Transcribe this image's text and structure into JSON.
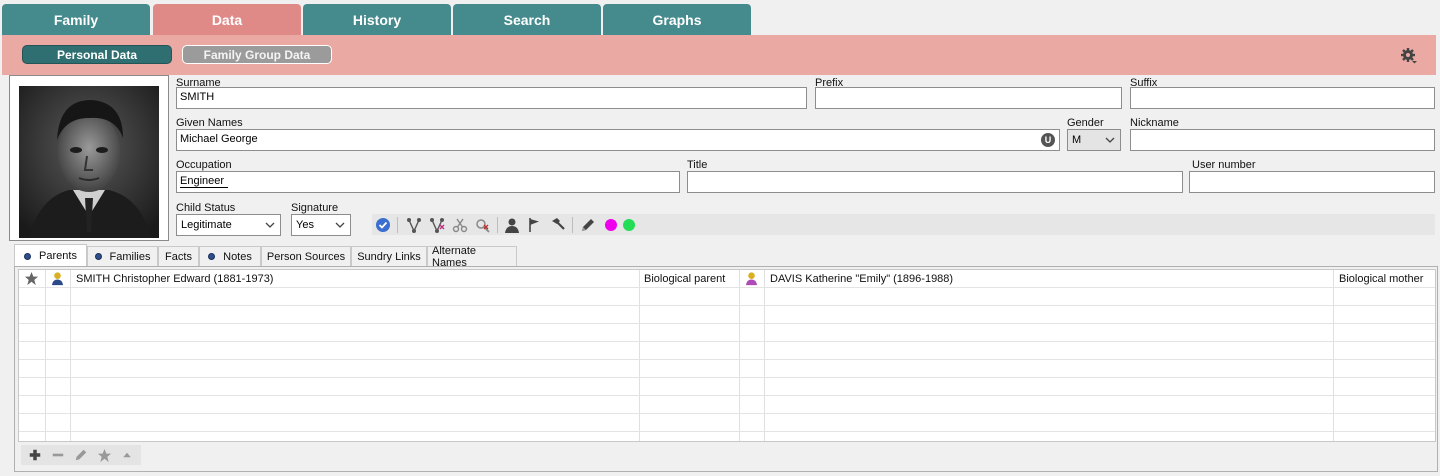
{
  "top_tabs": [
    {
      "label": "Family"
    },
    {
      "label": "Data"
    },
    {
      "label": "History"
    },
    {
      "label": "Search"
    },
    {
      "label": "Graphs"
    }
  ],
  "sub_pills": {
    "personal": "Personal Data",
    "family_group": "Family Group Data"
  },
  "fields": {
    "surname": {
      "label": "Surname",
      "value": "SMITH"
    },
    "prefix": {
      "label": "Prefix",
      "value": ""
    },
    "suffix": {
      "label": "Suffix",
      "value": ""
    },
    "given_names": {
      "label": "Given Names",
      "value": "Michael George"
    },
    "gender": {
      "label": "Gender",
      "value": "M"
    },
    "nickname": {
      "label": "Nickname",
      "value": ""
    },
    "occupation": {
      "label": "Occupation",
      "value": "Engineer"
    },
    "title": {
      "label": "Title",
      "value": ""
    },
    "user_number": {
      "label": "User number",
      "value": ""
    },
    "child_status": {
      "label": "Child Status",
      "value": "Legitimate"
    },
    "signature": {
      "label": "Signature",
      "value": "Yes"
    }
  },
  "given_names_badge": "U",
  "toolbar": {
    "icons": [
      "check-circle-icon",
      "branch-icon",
      "branch-remove-icon",
      "cut-icon",
      "unlink-icon",
      "person-icon",
      "flag-icon",
      "hammer-icon",
      "pencil-icon"
    ],
    "color_dots": [
      "#ee00ee",
      "#22dd55"
    ]
  },
  "subtabs": [
    {
      "label": "Parents",
      "dot": true
    },
    {
      "label": "Families",
      "dot": true
    },
    {
      "label": "Facts",
      "dot": false
    },
    {
      "label": "Notes",
      "dot": true
    },
    {
      "label": "Person Sources",
      "dot": false
    },
    {
      "label": "Sundry Links",
      "dot": false
    },
    {
      "label": "Alternate Names",
      "dot": false
    }
  ],
  "parents": {
    "father_name": "SMITH Christopher Edward (1881-1973)",
    "father_relation": "Biological parent",
    "mother_name": "DAVIS Katherine \"Emily\" (1896-1988)",
    "mother_relation": "Biological mother",
    "colors": {
      "father_icon": "#d8b020",
      "mother_icon": "#b04ab8"
    }
  },
  "colors": {
    "tab_teal": "#458a8c",
    "tab_active": "#e08a88",
    "band_pink": "#eba9a4",
    "pill_active": "#2f6f71"
  }
}
